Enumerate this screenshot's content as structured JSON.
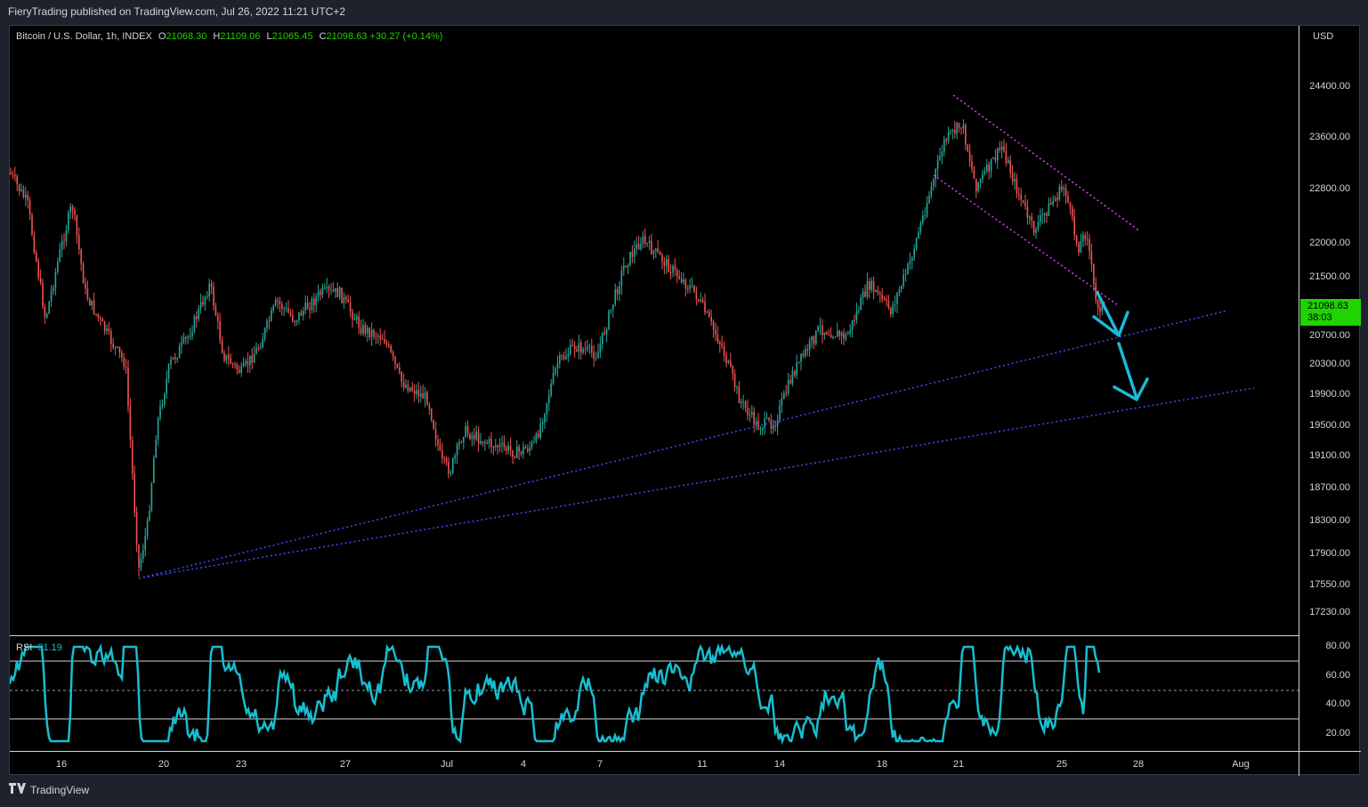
{
  "header": {
    "published": "FieryTrading published on TradingView.com, Jul 26, 2022 11:21 UTC+2"
  },
  "legend": {
    "symbol": "Bitcoin / U.S. Dollar, 1h, INDEX",
    "o_key": "O",
    "o": "21068.30",
    "h_key": "H",
    "h": "21109.06",
    "l_key": "L",
    "l": "21065.45",
    "c_key": "C",
    "c": "21098.63",
    "change": "+30.27 (+0.14%)"
  },
  "price_axis": {
    "currency": "USD",
    "labels": [
      "24400.00",
      "23600.00",
      "22800.00",
      "22000.00",
      "21500.00",
      "20700.00",
      "20300.00",
      "19900.00",
      "19500.00",
      "19100.00",
      "18700.00",
      "18300.00",
      "17900.00",
      "17550.00",
      "17230.00"
    ],
    "current_price": "21098.63",
    "countdown": "38:03"
  },
  "rsi": {
    "label": "RSI",
    "value": "31.19",
    "axis": [
      "80.00",
      "60.00",
      "40.00",
      "20.00"
    ]
  },
  "time_axis": [
    "16",
    "20",
    "23",
    "27",
    "Jul",
    "4",
    "7",
    "11",
    "14",
    "18",
    "21",
    "25",
    "28",
    "Aug"
  ],
  "footer": {
    "brand": "TradingView"
  },
  "colors": {
    "up": "#26a69a",
    "down": "#ef5350",
    "rsi_line": "#17becf",
    "channel": "#e040fb",
    "trend": "#3d4bff",
    "arrow": "#1eb8d8",
    "price_tag": "#1fd400"
  }
}
